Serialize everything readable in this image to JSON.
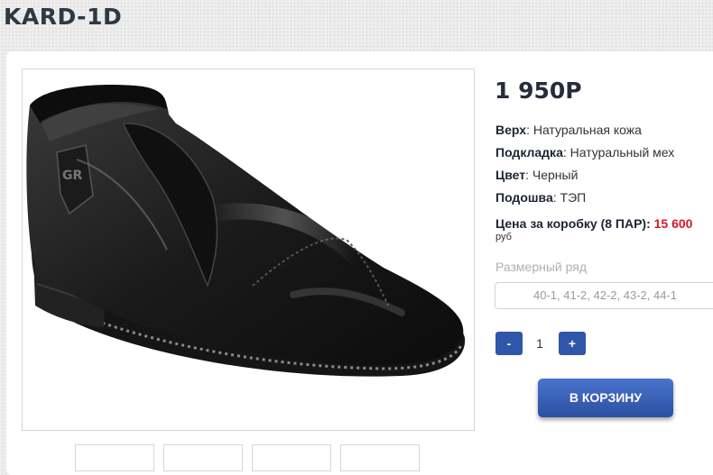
{
  "product": {
    "title": "KARD-1D",
    "price": "1 950P",
    "image_icon": "boot-photo"
  },
  "properties": [
    {
      "label": "Верх",
      "value": ": Натуральная кожа"
    },
    {
      "label": "Подкладка",
      "value": ": Натуральный мех"
    },
    {
      "label": "Цвет",
      "value": ": Черный"
    },
    {
      "label": "Подошва",
      "value": ": ТЭП"
    }
  ],
  "box": {
    "label": "Цена за коробку (8 ПАР): ",
    "price": "15 600",
    "currency": "руб"
  },
  "sizes": {
    "label": "Размерный ряд",
    "value": "40-1, 41-2, 42-2, 43-2, 44-1"
  },
  "quantity": {
    "minus": "-",
    "value": "1",
    "plus": "+"
  },
  "cart": {
    "label": "В КОРЗИНУ"
  },
  "colors": {
    "accent": "#2f56a8",
    "price_red": "#d6162b"
  }
}
